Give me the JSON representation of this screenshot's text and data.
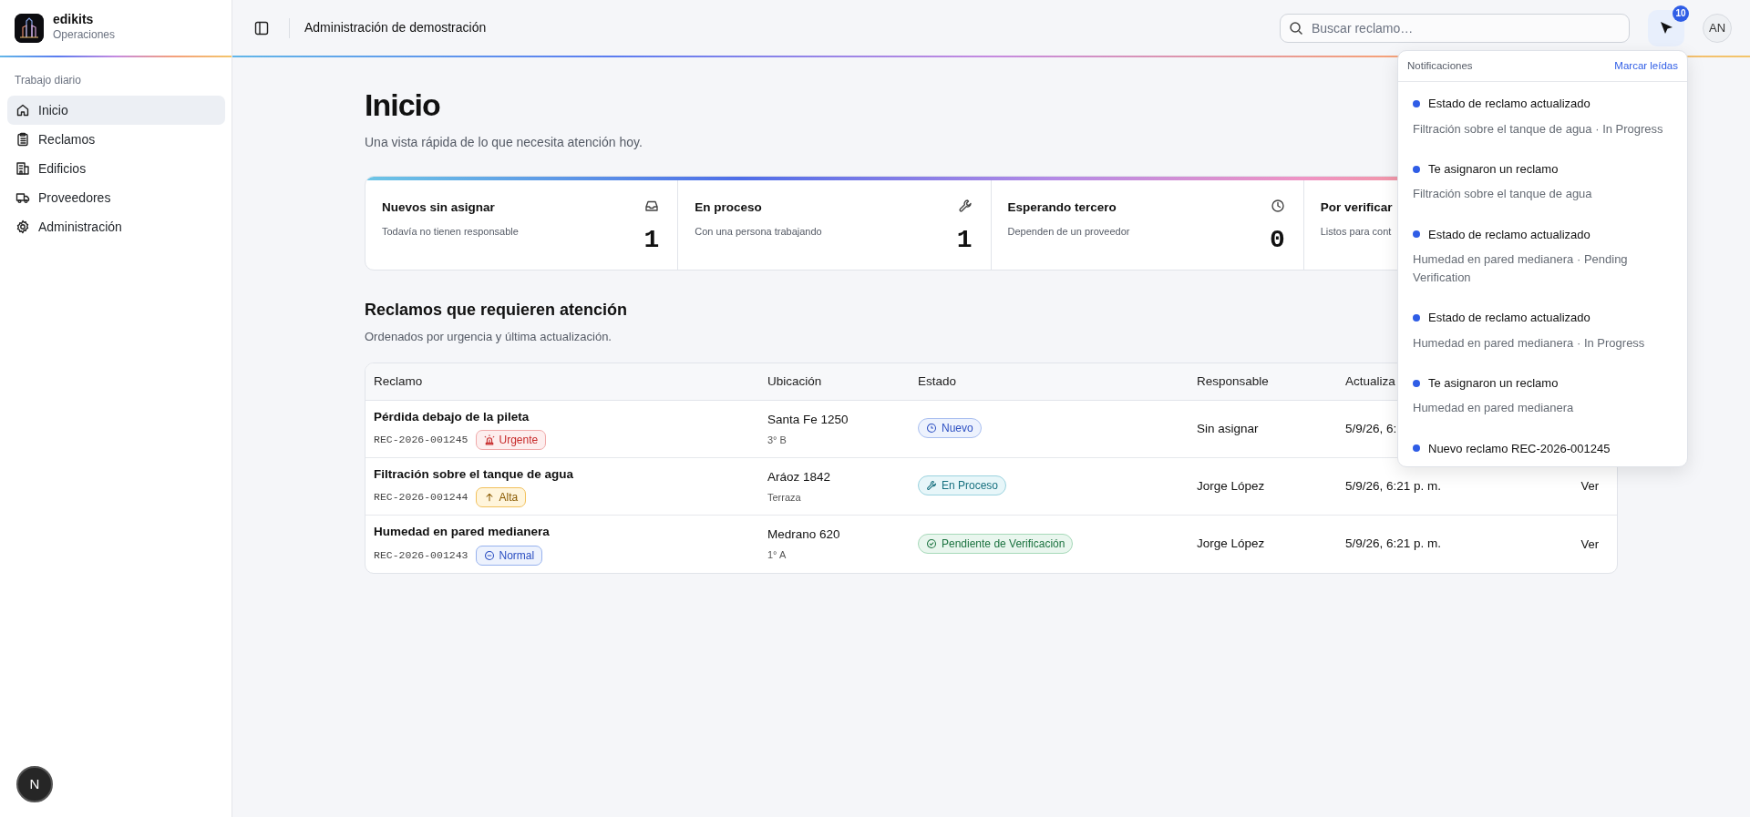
{
  "brand": {
    "name": "edikits",
    "subtitle": "Operaciones"
  },
  "header": {
    "title": "Administración de demostración",
    "search": {
      "placeholder": "Buscar reclamo…"
    },
    "notifications_count": "10",
    "avatar": "AN"
  },
  "sidebar": {
    "section": "Trabajo diario",
    "items": [
      {
        "label": "Inicio",
        "kind": "home",
        "selected": true
      },
      {
        "label": "Reclamos",
        "kind": "clipboard",
        "selected": false
      },
      {
        "label": "Edificios",
        "kind": "building",
        "selected": false
      },
      {
        "label": "Proveedores",
        "kind": "truck",
        "selected": false
      },
      {
        "label": "Administración",
        "kind": "gear",
        "selected": false
      }
    ]
  },
  "page": {
    "title": "Inicio",
    "subtitle": "Una vista rápida de lo que necesita atención hoy."
  },
  "stats": [
    {
      "kind": "inbox",
      "title": "Nuevos sin asignar",
      "description": "Todavía no tienen responsable",
      "value": "1"
    },
    {
      "kind": "wrench",
      "title": "En proceso",
      "description": "Con una persona trabajando",
      "value": "1"
    },
    {
      "kind": "clock",
      "title": "Esperando tercero",
      "description": "Dependen de un proveedor",
      "value": "0"
    },
    {
      "kind": "hidden",
      "title": "Por verificar",
      "description": "Listos para cont"
    }
  ],
  "claims": {
    "title": "Reclamos que requieren atención",
    "subtitle": "Ordenados por urgencia y última actualización.",
    "columns": [
      "Reclamo",
      "Ubicación",
      "Estado",
      "Responsable",
      "Actualiza"
    ],
    "rows": [
      {
        "title": "Pérdida debajo de la pileta",
        "code": "REC-2026-001245",
        "priority": {
          "kind": "urgent",
          "label": "Urgente"
        },
        "address": "Santa Fe 1250",
        "unit": "3° B",
        "status": {
          "kind": "new",
          "label": "Nuevo"
        },
        "assignee": "Sin asignar",
        "updated": "5/9/26, 6:"
      },
      {
        "title": "Filtración sobre el tanque de agua",
        "code": "REC-2026-001244",
        "priority": {
          "kind": "high",
          "label": "Alta"
        },
        "address": "Aráoz 1842",
        "unit": "Terraza",
        "status": {
          "kind": "in_progress",
          "label": "En Proceso"
        },
        "assignee": "Jorge López",
        "updated": "5/9/26, 6:21 p. m.",
        "action": "Ver"
      },
      {
        "title": "Humedad en pared medianera",
        "code": "REC-2026-001243",
        "priority": {
          "kind": "normal",
          "label": "Normal"
        },
        "address": "Medrano 620",
        "unit": "1° A",
        "status": {
          "kind": "pending_verification",
          "label": "Pendiente de Verificación"
        },
        "assignee": "Jorge López",
        "updated": "5/9/26, 6:21 p. m.",
        "action": "Ver"
      }
    ]
  },
  "notifications": {
    "title": "Notificaciones",
    "action": "Marcar leídas",
    "items": [
      {
        "title": "Estado de reclamo actualizado",
        "detail": "Filtración sobre el tanque de agua · In Progress",
        "unread": true
      },
      {
        "title": "Te asignaron un reclamo",
        "detail": "Filtración sobre el tanque de agua",
        "unread": true
      },
      {
        "title": "Estado de reclamo actualizado",
        "detail": "Humedad en pared medianera · Pending Verification",
        "unread": true
      },
      {
        "title": "Estado de reclamo actualizado",
        "detail": "Humedad en pared medianera · In Progress",
        "unread": true
      },
      {
        "title": "Te asignaron un reclamo",
        "detail": "Humedad en pared medianera",
        "unread": true
      },
      {
        "title": "Nuevo reclamo REC-2026-001245",
        "unread": true
      }
    ]
  },
  "dev_indicator": {
    "label": "N"
  }
}
